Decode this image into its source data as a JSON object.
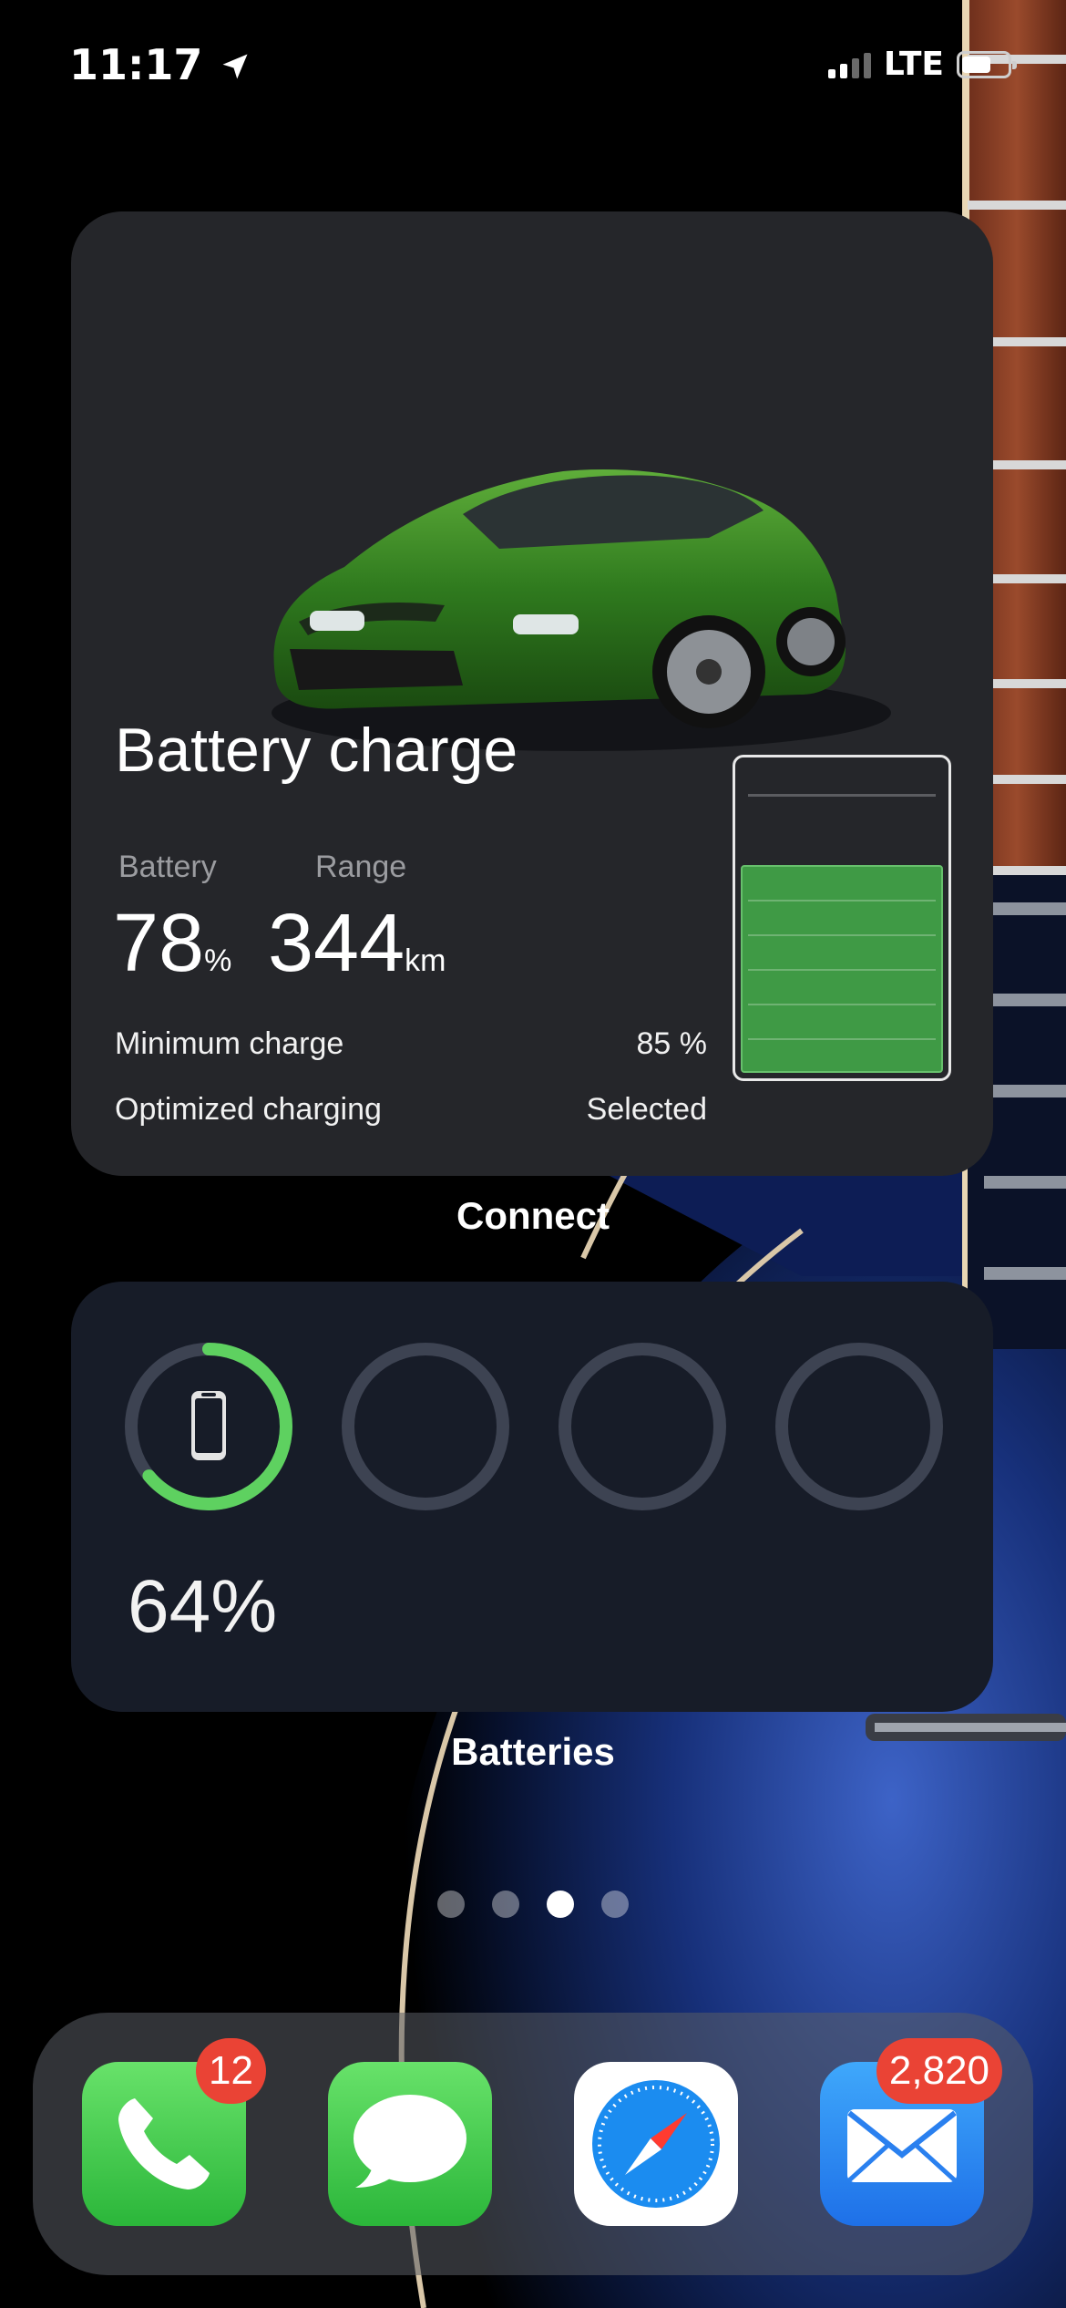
{
  "status_bar": {
    "time": "11:17",
    "location_icon": "location-arrow-icon",
    "network": "LTE",
    "signal_bars": 2,
    "battery_level": 0.64
  },
  "porsche_widget": {
    "car_image": "green-porsche-taycan",
    "title": "Battery charge",
    "battery_label": "Battery",
    "battery_value": "78",
    "battery_unit": "%",
    "range_label": "Range",
    "range_value": "344",
    "range_unit": "km",
    "min_charge_label": "Minimum charge",
    "min_charge_value": "85 %",
    "optimized_label": "Optimized charging",
    "optimized_value": "Selected",
    "charge_level": 0.78,
    "colors": {
      "charge_fill": "#3f9a45",
      "background": "#25262a"
    }
  },
  "connect_caption": "Connect",
  "batteries_widget": {
    "devices": [
      {
        "icon": "iphone-icon",
        "level": 0.64
      },
      {
        "icon": "",
        "level": 0
      },
      {
        "icon": "",
        "level": 0
      },
      {
        "icon": "",
        "level": 0
      }
    ],
    "percent": "64%",
    "colors": {
      "ring": "#5ed160",
      "empty_ring": "#3d4352"
    }
  },
  "batteries_caption": "Batteries",
  "page_dots": {
    "count": 4,
    "active": 2
  },
  "dock": {
    "apps": [
      {
        "name": "Phone",
        "icon": "phone-icon",
        "badge": "12"
      },
      {
        "name": "Messages",
        "icon": "messages-icon",
        "badge": ""
      },
      {
        "name": "Safari",
        "icon": "compass-icon",
        "badge": ""
      },
      {
        "name": "Mail",
        "icon": "envelope-icon",
        "badge": "2,820"
      }
    ]
  }
}
